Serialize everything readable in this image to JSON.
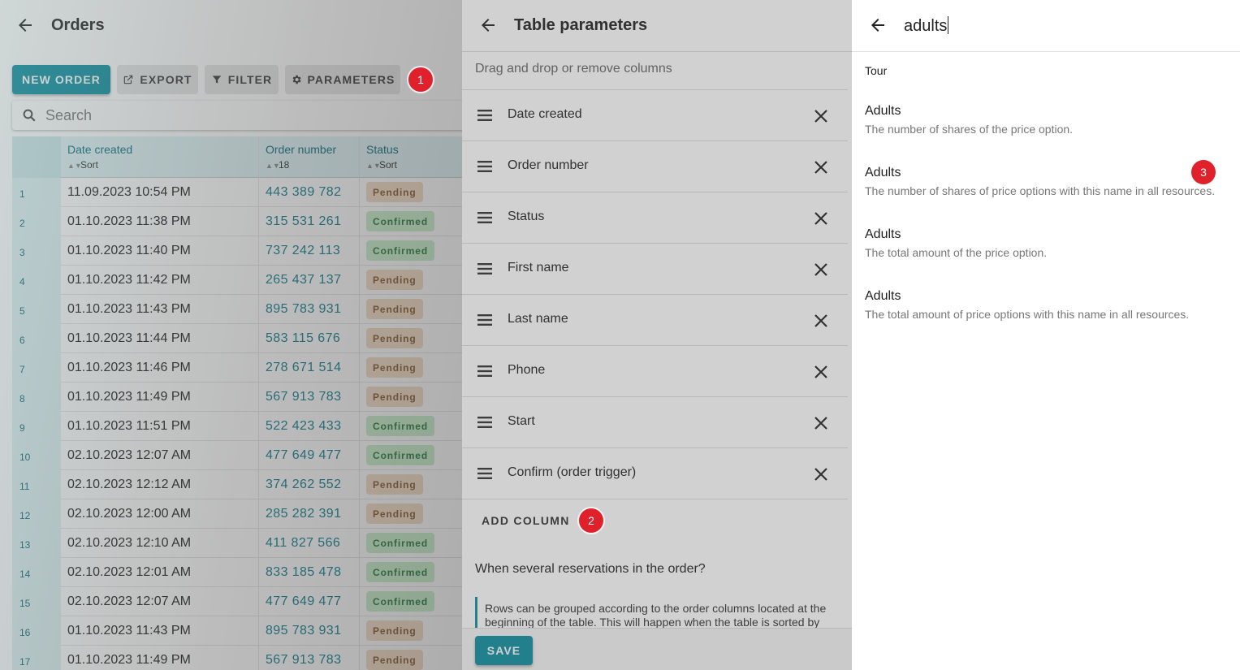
{
  "orders": {
    "title": "Orders",
    "buttons": {
      "new_order": "NEW ORDER",
      "export": "EXPORT",
      "filter": "FILTER",
      "parameters": "PARAMETERS"
    },
    "search_placeholder": "Search",
    "columns": [
      {
        "name": "Date created",
        "sub": "Sort"
      },
      {
        "name": "Order number",
        "sub": "18"
      },
      {
        "name": "Status",
        "sub": "Sort"
      }
    ],
    "rows": [
      {
        "n": "1",
        "date": "11.09.2023 10:54 PM",
        "order": "443 389 782",
        "status": "Pending"
      },
      {
        "n": "2",
        "date": "01.10.2023 11:38 PM",
        "order": "315 531 261",
        "status": "Confirmed"
      },
      {
        "n": "3",
        "date": "01.10.2023 11:40 PM",
        "order": "737 242 113",
        "status": "Confirmed"
      },
      {
        "n": "4",
        "date": "01.10.2023 11:42 PM",
        "order": "265 437 137",
        "status": "Pending"
      },
      {
        "n": "5",
        "date": "01.10.2023 11:43 PM",
        "order": "895 783 931",
        "status": "Pending"
      },
      {
        "n": "6",
        "date": "01.10.2023 11:44 PM",
        "order": "583 115 676",
        "status": "Pending"
      },
      {
        "n": "7",
        "date": "01.10.2023 11:46 PM",
        "order": "278 671 514",
        "status": "Pending"
      },
      {
        "n": "8",
        "date": "01.10.2023 11:49 PM",
        "order": "567 913 783",
        "status": "Pending"
      },
      {
        "n": "9",
        "date": "01.10.2023 11:51 PM",
        "order": "522 423 433",
        "status": "Confirmed"
      },
      {
        "n": "10",
        "date": "02.10.2023 12:07 AM",
        "order": "477 649 477",
        "status": "Confirmed"
      },
      {
        "n": "11",
        "date": "02.10.2023 12:12 AM",
        "order": "374 262 552",
        "status": "Pending"
      },
      {
        "n": "12",
        "date": "02.10.2023 12:00 AM",
        "order": "285 282 391",
        "status": "Pending"
      },
      {
        "n": "13",
        "date": "02.10.2023 12:10 AM",
        "order": "411 827 566",
        "status": "Confirmed"
      },
      {
        "n": "14",
        "date": "02.10.2023 12:01 AM",
        "order": "833 185 478",
        "status": "Confirmed"
      },
      {
        "n": "15",
        "date": "02.10.2023 12:07 AM",
        "order": "477 649 477",
        "status": "Confirmed"
      },
      {
        "n": "16",
        "date": "01.10.2023 11:43 PM",
        "order": "895 783 931",
        "status": "Pending"
      },
      {
        "n": "17",
        "date": "01.10.2023 11:49 PM",
        "order": "567 913 783",
        "status": "Pending"
      }
    ]
  },
  "params": {
    "title": "Table parameters",
    "hint": "Drag and drop or remove columns",
    "columns": [
      "Date created",
      "Order number",
      "Status",
      "First name",
      "Last name",
      "Phone",
      "Start",
      "Confirm (order trigger)"
    ],
    "add_column": "ADD COLUMN",
    "question": "When several reservations in the order?",
    "note": "Rows can be grouped according to the order columns located at the beginning of the table. This will happen when the table is sorted by",
    "save": "SAVE"
  },
  "search": {
    "query": "adults",
    "group": "Tour",
    "results": [
      {
        "name": "Adults",
        "desc": "The number of shares of the price option."
      },
      {
        "name": "Adults",
        "desc": "The number of shares of price options with this name in all resources."
      },
      {
        "name": "Adults",
        "desc": "The total amount of the price option."
      },
      {
        "name": "Adults",
        "desc": "The total amount of price options with this name in all resources."
      }
    ]
  },
  "callouts": [
    "1",
    "2",
    "3"
  ],
  "colors": {
    "accent": "#0c8fa0",
    "badge": "#e0202a",
    "pending_bg": "#f3dcc4",
    "confirmed_bg": "#c8f0cc"
  },
  "icons": [
    "back-arrow-icon",
    "export-icon",
    "filter-icon",
    "gear-icon",
    "search-icon",
    "drag-handle-icon",
    "close-icon",
    "sort-icon"
  ]
}
